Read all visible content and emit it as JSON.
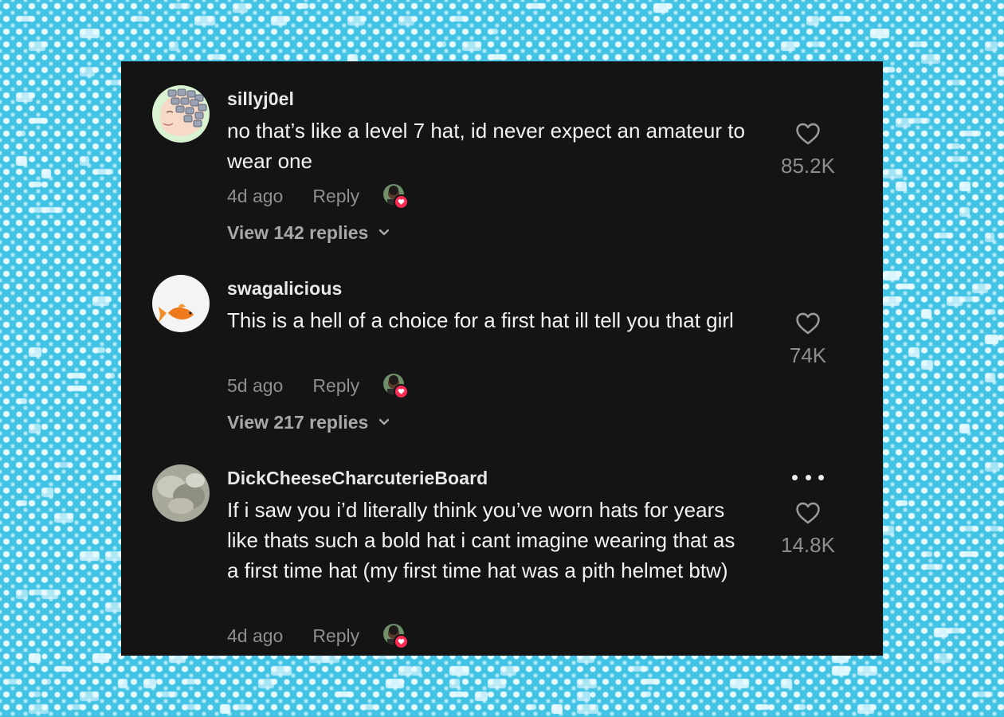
{
  "colors": {
    "background": "#43c3e4",
    "pattern": "#e8faff",
    "panel": "#141414",
    "username": "#e8e8e8",
    "text": "#f2f2f2",
    "muted": "#8e8e8e",
    "like_badge": "#fe2c55"
  },
  "comments": [
    {
      "username": "sillyj0el",
      "text": "no that’s like a level 7 hat, id never expect an amateur to wear one",
      "date": "4d ago",
      "reply_label": "Reply",
      "likes": "85.2K",
      "view_replies": "View 142 replies",
      "avatar_icon": "cartoon-woman-with-rollers-avatar",
      "liked_by_creator": true
    },
    {
      "username": "swagalicious",
      "text": "This is a hell of a choice for a first hat ill tell you that girl",
      "date": "5d ago",
      "reply_label": "Reply",
      "likes": "74K",
      "view_replies": "View 217 replies",
      "avatar_icon": "goldfish-avatar",
      "liked_by_creator": true
    },
    {
      "username": "DickCheeseCharcuterieBoard",
      "text": "If i saw you i’d literally think you’ve worn hats for years like thats such a bold hat i cant imagine wearing that as a first time hat (my first time hat was a pith helmet btw)",
      "date": "4d ago",
      "reply_label": "Reply",
      "likes": "14.8K",
      "avatar_icon": "blurry-photo-avatar",
      "liked_by_creator": true,
      "has_more_menu": true
    }
  ]
}
